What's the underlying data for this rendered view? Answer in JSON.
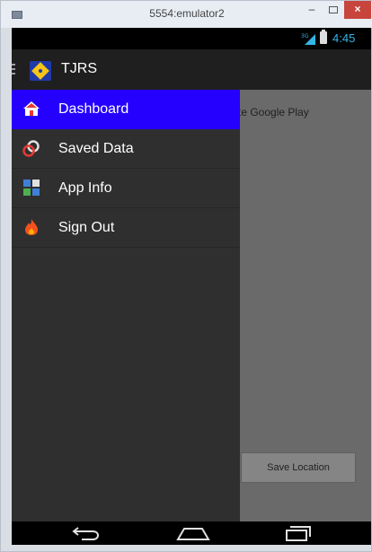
{
  "window": {
    "title": "5554:emulator2",
    "minimize": "–",
    "close": "×"
  },
  "status_bar": {
    "network": "3G",
    "time": "4:45"
  },
  "action_bar": {
    "title": "TJRS",
    "icon": "app-logo-icon"
  },
  "drawer": {
    "items": [
      {
        "label": "Dashboard",
        "icon": "home-icon",
        "active": true
      },
      {
        "label": "Saved Data",
        "icon": "saved-data-icon",
        "active": false
      },
      {
        "label": "App Info",
        "icon": "app-info-icon",
        "active": false
      },
      {
        "label": "Sign Out",
        "icon": "sign-out-icon",
        "active": false
      }
    ]
  },
  "content": {
    "partial_text": "te Google Play",
    "save_button_label": "Save Location"
  },
  "nav_bar": {
    "back_icon": "back-icon",
    "home_icon": "home-nav-icon",
    "recents_icon": "recents-icon"
  },
  "colors": {
    "drawer_active": "#2500ff",
    "drawer_bg": "#2f2f2f",
    "clock": "#33b5e5",
    "close_button": "#c7453d"
  }
}
